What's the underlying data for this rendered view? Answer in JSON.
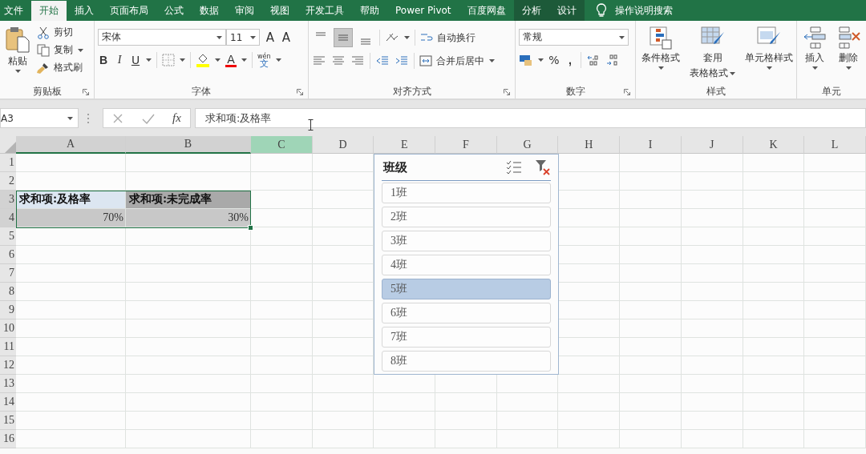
{
  "tabs": [
    {
      "label": "文件",
      "selected": false,
      "contextual": false
    },
    {
      "label": "开始",
      "selected": true,
      "contextual": false
    },
    {
      "label": "插入",
      "selected": false,
      "contextual": false
    },
    {
      "label": "页面布局",
      "selected": false,
      "contextual": false
    },
    {
      "label": "公式",
      "selected": false,
      "contextual": false
    },
    {
      "label": "数据",
      "selected": false,
      "contextual": false
    },
    {
      "label": "审阅",
      "selected": false,
      "contextual": false
    },
    {
      "label": "视图",
      "selected": false,
      "contextual": false
    },
    {
      "label": "开发工具",
      "selected": false,
      "contextual": false
    },
    {
      "label": "帮助",
      "selected": false,
      "contextual": false
    },
    {
      "label": "Power Pivot",
      "selected": false,
      "contextual": false
    },
    {
      "label": "百度网盘",
      "selected": false,
      "contextual": false
    },
    {
      "label": "分析",
      "selected": false,
      "contextual": true
    },
    {
      "label": "设计",
      "selected": false,
      "contextual": true
    }
  ],
  "tell_me": "操作说明搜索",
  "ribbon": {
    "clipboard": {
      "paste": "粘贴",
      "cut": "剪切",
      "copy": "复制",
      "format_painter": "格式刷",
      "label": "剪贴板"
    },
    "font": {
      "font_name": "宋体",
      "font_size": "11",
      "grow": "A",
      "shrink": "A",
      "bold": "B",
      "italic": "I",
      "underline": "U",
      "font_color": "A",
      "phonetic_top": "wén",
      "phonetic_bottom": "文",
      "label": "字体"
    },
    "alignment": {
      "wrap": "自动换行",
      "merge": "合并后居中",
      "label": "对齐方式"
    },
    "number": {
      "format": "常规",
      "percent": "%",
      "comma": ",",
      "label": "数字"
    },
    "styles": {
      "conditional": "条件格式",
      "table_line1": "套用",
      "table_line2": "表格格式",
      "cell_styles": "单元格样式",
      "label": "样式"
    },
    "cells": {
      "insert": "插入",
      "delete": "删除",
      "label": "单元"
    }
  },
  "formula_bar": {
    "name_box": "A3",
    "fx": "fx",
    "formula": "求和项:及格率"
  },
  "columns": [
    {
      "label": "A",
      "selected": true,
      "hovered": false
    },
    {
      "label": "B",
      "selected": true,
      "hovered": false
    },
    {
      "label": "C",
      "selected": false,
      "hovered": true
    },
    {
      "label": "D",
      "selected": false,
      "hovered": false
    },
    {
      "label": "E",
      "selected": false,
      "hovered": false
    },
    {
      "label": "F",
      "selected": false,
      "hovered": false
    },
    {
      "label": "G",
      "selected": false,
      "hovered": false
    },
    {
      "label": "H",
      "selected": false,
      "hovered": false
    },
    {
      "label": "I",
      "selected": false,
      "hovered": false
    },
    {
      "label": "J",
      "selected": false,
      "hovered": false
    },
    {
      "label": "K",
      "selected": false,
      "hovered": false
    },
    {
      "label": "L",
      "selected": false,
      "hovered": false
    }
  ],
  "rows": [
    {
      "label": "1",
      "selected": false
    },
    {
      "label": "2",
      "selected": false
    },
    {
      "label": "3",
      "selected": true,
      "cells": [
        {
          "text": "求和项:及格率",
          "kind": "header",
          "selected": true
        },
        {
          "text": "求和项:未完成率",
          "kind": "header",
          "selected": false
        }
      ]
    },
    {
      "label": "4",
      "selected": true,
      "cells": [
        {
          "text": "70%",
          "kind": "value",
          "selected": false
        },
        {
          "text": "30%",
          "kind": "value",
          "selected": false
        }
      ]
    },
    {
      "label": "5",
      "selected": false
    },
    {
      "label": "6",
      "selected": false
    },
    {
      "label": "7",
      "selected": false
    },
    {
      "label": "8",
      "selected": false
    },
    {
      "label": "9",
      "selected": false
    },
    {
      "label": "10",
      "selected": false
    },
    {
      "label": "11",
      "selected": false
    },
    {
      "label": "12",
      "selected": false
    },
    {
      "label": "13",
      "selected": false
    },
    {
      "label": "14",
      "selected": false
    },
    {
      "label": "15",
      "selected": false
    },
    {
      "label": "16",
      "selected": false
    }
  ],
  "slicer": {
    "title": "班级",
    "items": [
      {
        "label": "1班",
        "selected": false
      },
      {
        "label": "2班",
        "selected": false
      },
      {
        "label": "3班",
        "selected": false
      },
      {
        "label": "4班",
        "selected": false
      },
      {
        "label": "5班",
        "selected": true
      },
      {
        "label": "6班",
        "selected": false
      },
      {
        "label": "7班",
        "selected": false
      },
      {
        "label": "8班",
        "selected": false
      }
    ]
  }
}
